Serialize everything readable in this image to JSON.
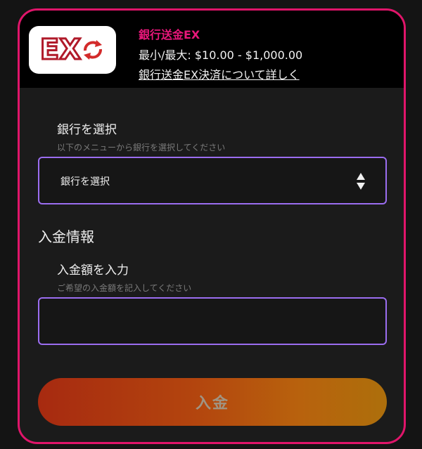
{
  "provider": {
    "name": "銀行送金EX",
    "limits": "最小/最大: $10.00 - $1,000.00",
    "info_link": "銀行送金EX決済について詳しく",
    "logo_text": "EX",
    "accent_color": "#e0156a"
  },
  "bank": {
    "label": "銀行を選択",
    "hint": "以下のメニューから銀行を選択してください",
    "selected": "銀行を選択"
  },
  "deposit_info": {
    "title": "入金情報",
    "amount_label": "入金額を入力",
    "amount_hint": "ご希望の入金額を記入してください",
    "amount_value": ""
  },
  "submit": {
    "label": "入金"
  }
}
